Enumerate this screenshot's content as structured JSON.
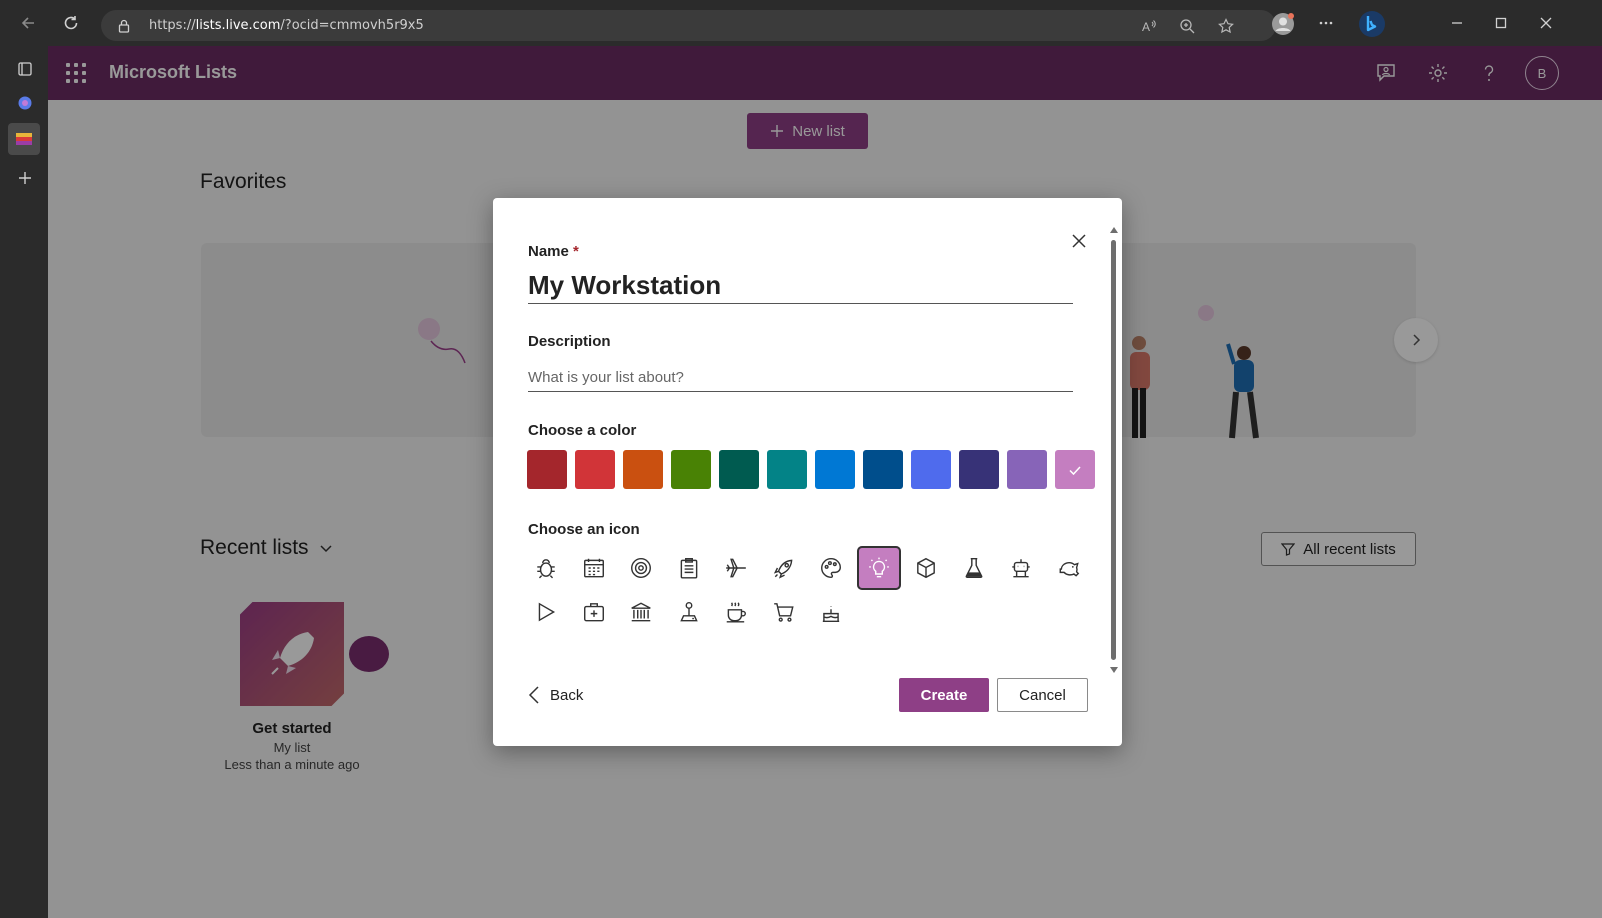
{
  "browser": {
    "url_prefix": "https://",
    "url_host": "lists.live.com",
    "url_path": "/?ocid=cmmovh5r9x5"
  },
  "app": {
    "title": "Microsoft Lists",
    "avatar_initial": "B",
    "brand_color": "#6b2c63"
  },
  "page": {
    "new_list_label": "New list",
    "favorites_title": "Favorites",
    "recent_title": "Recent lists",
    "all_recent_label": "All recent lists",
    "recent_items": [
      {
        "title": "Get started",
        "subtitle": "My list",
        "time": "Less than a minute ago"
      }
    ]
  },
  "dialog": {
    "name_label": "Name",
    "required_mark": "*",
    "name_value": "My Workstation",
    "description_label": "Description",
    "description_placeholder": "What is your list about?",
    "color_label": "Choose a color",
    "colors": [
      "#a4262c",
      "#d13438",
      "#ca5010",
      "#498205",
      "#005b50",
      "#038387",
      "#0078d4",
      "#004e8c",
      "#4f6bed",
      "#373277",
      "#8764b8",
      "#c47ec0"
    ],
    "selected_color_index": 11,
    "icon_label": "Choose an icon",
    "icons": [
      "bug-icon",
      "calendar-icon",
      "target-icon",
      "clipboard-icon",
      "airplane-icon",
      "rocket-icon",
      "palette-icon",
      "lightbulb-icon",
      "cube-icon",
      "beaker-icon",
      "robot-icon",
      "piggy-bank-icon",
      "play-icon",
      "medical-kit-icon",
      "bank-icon",
      "joystick-icon",
      "coffee-icon",
      "cart-icon",
      "cake-icon"
    ],
    "selected_icon_index": 7,
    "back_label": "Back",
    "create_label": "Create",
    "cancel_label": "Cancel"
  }
}
